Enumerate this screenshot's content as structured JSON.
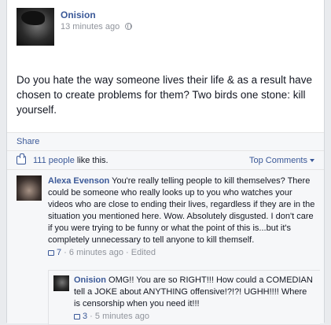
{
  "post": {
    "author": "Onision",
    "timestamp": "13 minutes ago",
    "text": "Do you hate the way someone lives their life & as a result have chosen to create problems for them? Two birds one stone: kill yourself."
  },
  "actions": {
    "share_label": "Share"
  },
  "likes": {
    "count_text": "111 people",
    "suffix": " like this.",
    "sort_label": "Top Comments"
  },
  "comments": [
    {
      "author": "Alexa Evenson",
      "text": " You're really telling people to kill themselves? There could be someone who really looks up to you who watches your videos who are close to ending their lives, regardless if they are in the situation you mentioned here. Wow. Absolutely disgusted. I don't care if you were trying to be funny or what the point of this is...but it's completely unnecessary to tell anyone to kill themself.",
      "likes": "7",
      "timestamp": " · 6 minutes ago · Edited"
    },
    {
      "author": "Onision",
      "text": " OMG!! You are so RIGHT!!! How could a COMEDIAN tell a JOKE about ANYTHING offensive!?!?! UGHH!!!! Where is censorship when you need it!!!",
      "likes": "3",
      "timestamp": " · 5 minutes ago"
    }
  ],
  "icons": {
    "privacy": "globe-icon",
    "like": "thumbs-up-icon",
    "sort": "chevron-down-icon"
  },
  "colors": {
    "link": "#3b5998",
    "muted": "#90949c",
    "panel": "#f6f7f9"
  }
}
